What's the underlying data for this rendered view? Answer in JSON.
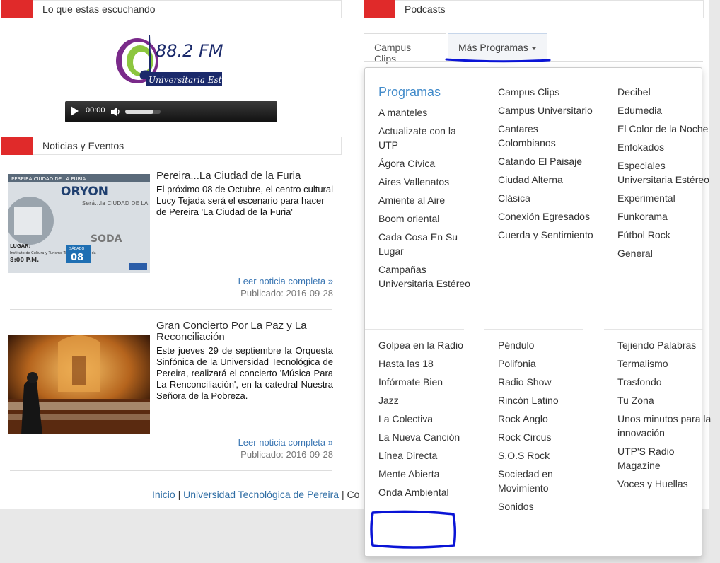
{
  "sections": {
    "listening": "Lo que estas escuchando",
    "podcasts": "Podcasts",
    "news": "Noticias y Eventos"
  },
  "logo": {
    "frequency": "88.2 FM",
    "subtitle": "Universitaria Estéreo"
  },
  "player": {
    "time": "00:00",
    "volume_level": 0.8
  },
  "news": [
    {
      "title": "Pereira...La Ciudad de la Furia",
      "body": "El próximo 08 de Octubre, el centro cultural Lucy Tejada será el escenario para hacer de Pereira 'La Ciudad de la Furia'",
      "read_more": "Leer noticia completa »",
      "published": "Publicado: 2016-09-28",
      "poster": {
        "banner": "PEREIRA CIUDAD DE LA FURIA",
        "band": "ORYON",
        "tagline": "Será...la CIUDAD DE LA FURIA",
        "band2": "SODA",
        "lugar": "LUGAR:",
        "venue": "Instituto de Cultura y Turismo Teatro Lucy Tejada",
        "hour": "8:00 P.M.",
        "day": "SÁBADO",
        "date": "08"
      }
    },
    {
      "title": "Gran Concierto Por La Paz y La Reconciliación",
      "body": "Este jueves 29 de septiembre la Orquesta Sinfónica de la Universidad Tecnológica de Pereira, realizará el concierto 'Música Para La Renconciliación', en la catedral Nuestra Señora de la Pobreza.",
      "read_more": "Leer noticia completa »",
      "published": "Publicado: 2016-09-28"
    }
  ],
  "footer": {
    "home": "Inicio",
    "sep": "|",
    "university": "Universidad Tecnológica de Pereira",
    "sep2": "|",
    "truncated": "Co"
  },
  "tabs": {
    "campus_clips": "Campus Clips",
    "more_programs": "Más Programas"
  },
  "dropdown": {
    "heading": "Programas",
    "col1_top": [
      "A manteles",
      "Actualizate con la UTP",
      "Ágora Cívica",
      "Aires Vallenatos",
      "Amiente al Aire",
      "Boom oriental",
      "Cada Cosa En Su Lugar",
      "Campañas Universitaria Estéreo"
    ],
    "col2_top": [
      "Campus Clips",
      "Campus Universitario",
      "Cantares Colombianos",
      "Catando El Paisaje",
      "Ciudad Alterna",
      "Clásica",
      "Conexión Egresados",
      "Cuerda y Sentimiento"
    ],
    "col3_top": [
      "Decibel",
      "Edumedia",
      "El Color de la Noche",
      "Enfokados",
      "Especiales Universitaria Estéreo",
      "Experimental",
      "Funkorama",
      "Fútbol Rock",
      "General"
    ],
    "col1_bottom": [
      "Golpea en la Radio",
      "Hasta las 18",
      "Infórmate Bien",
      "Jazz",
      "La Colectiva",
      "La Nueva Canción",
      "Línea Directa",
      "Mente Abierta",
      "Onda Ambiental"
    ],
    "col2_bottom": [
      "Péndulo",
      "Polifonia",
      "Radio Show",
      "Rincón Latino",
      "Rock Anglo",
      "Rock Circus",
      "S.O.S Rock",
      "Sociedad en Movimiento",
      "Sonidos"
    ],
    "col3_bottom": [
      "Tejiendo Palabras",
      "Termalismo",
      "Trasfondo",
      "Tu Zona",
      "Unos minutos para la innovación",
      "UTP'S Radio Magazine",
      "Voces y Huellas"
    ]
  },
  "colors": {
    "accent_red": "#e02a2a",
    "link_blue": "#428bca",
    "annotation_blue": "#0a14d6"
  }
}
